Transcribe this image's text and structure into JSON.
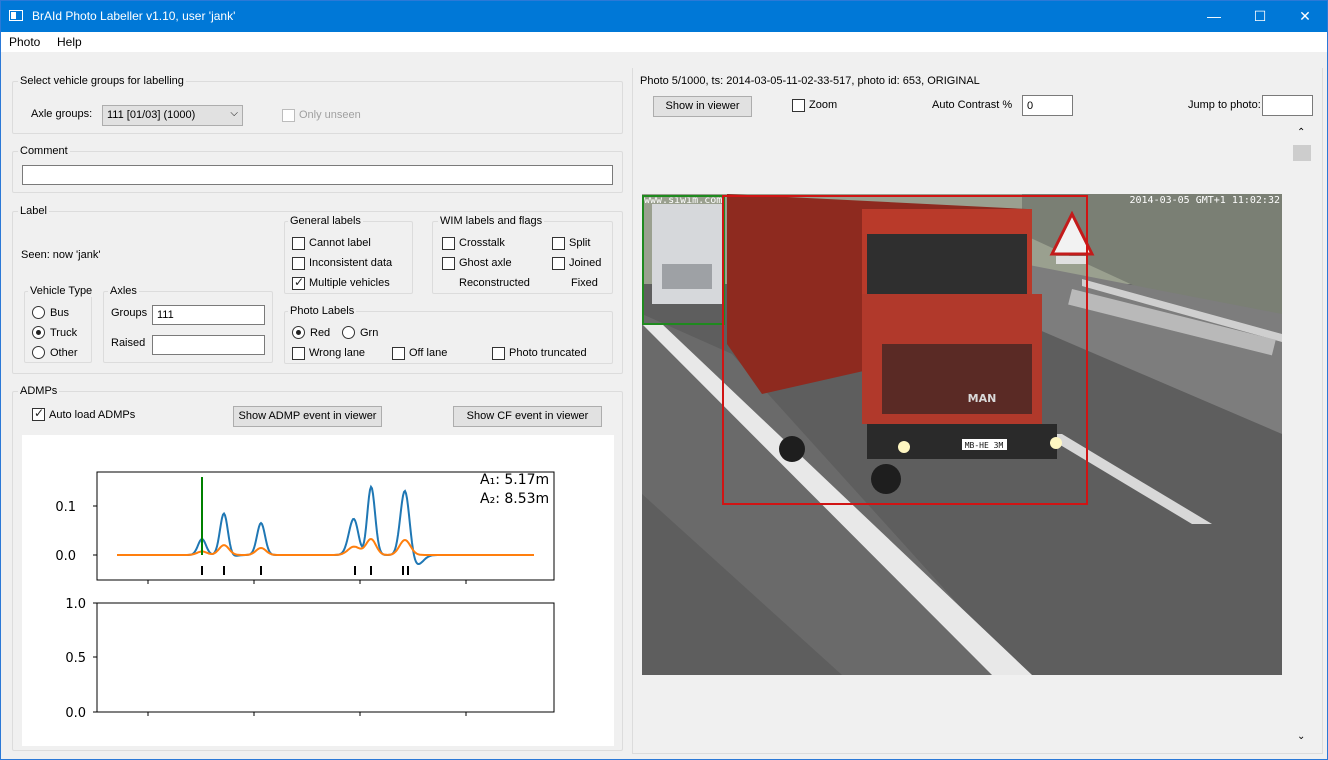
{
  "window": {
    "title": "BrAId Photo Labeller v1.10, user 'jank'",
    "minimize": "—",
    "maximize": "☐",
    "close": "✕"
  },
  "menu": [
    "Photo",
    "Help"
  ],
  "vehicle_groups": {
    "title": "Select vehicle groups for labelling",
    "axle_groups_label": "Axle groups:",
    "axle_groups_value": "111 [01/03] (1000)",
    "only_unseen": "Only unseen"
  },
  "comment": {
    "title": "Comment",
    "value": ""
  },
  "label": {
    "title": "Label",
    "seen": "Seen: now 'jank'",
    "vehicle_type": {
      "title": "Vehicle Type",
      "options": [
        "Bus",
        "Truck",
        "Other"
      ],
      "selected": "Truck"
    },
    "axles": {
      "title": "Axles",
      "groups_label": "Groups",
      "groups_value": "111",
      "raised_label": "Raised",
      "raised_value": ""
    },
    "general": {
      "title": "General labels",
      "items": [
        {
          "text": "Cannot label",
          "checked": false
        },
        {
          "text": "Inconsistent data",
          "checked": false
        },
        {
          "text": "Multiple vehicles",
          "checked": true
        }
      ]
    },
    "wim": {
      "title": "WIM labels and flags",
      "crosstalk": "Crosstalk",
      "ghost_axle": "Ghost axle",
      "reconstructed": "Reconstructed",
      "split": "Split",
      "joined": "Joined",
      "fixed": "Fixed"
    },
    "photo_labels": {
      "title": "Photo Labels",
      "red": "Red",
      "grn": "Grn",
      "selected": "Red",
      "wrong_lane": "Wrong lane",
      "off_lane": "Off lane",
      "photo_truncated": "Photo truncated"
    }
  },
  "admps": {
    "title": "ADMPs",
    "auto_load": "Auto load ADMPs",
    "auto_load_checked": true,
    "show_admp": "Show ADMP event in viewer",
    "show_cf": "Show CF event in viewer"
  },
  "photo": {
    "header": "Photo 5/1000, ts: 2014-03-05-11-02-33-517, photo id: 653, ORIGINAL",
    "show_in_viewer": "Show in viewer",
    "zoom": "Zoom",
    "auto_contrast_label": "Auto Contrast %",
    "auto_contrast_value": "0",
    "jump_label": "Jump to photo:",
    "jump_value": "",
    "overlay_left": "www.siwim.com",
    "overlay_right": "2014-03-05 GMT+1 11:02:32",
    "plate": "MB-HE 3M",
    "brand": "MAN"
  },
  "chart_data": [
    {
      "type": "line",
      "series": [
        {
          "color": "#1f77b4"
        },
        {
          "color": "#ff7f0e"
        }
      ],
      "yticks": [
        "0.0",
        "0.1"
      ],
      "annotations": [
        "A₁:  5.17m",
        "A₂:  8.53m"
      ],
      "marker_color": "#008000"
    },
    {
      "type": "line",
      "series": [],
      "yticks": [
        "0.0",
        "0.5",
        "1.0"
      ]
    }
  ]
}
